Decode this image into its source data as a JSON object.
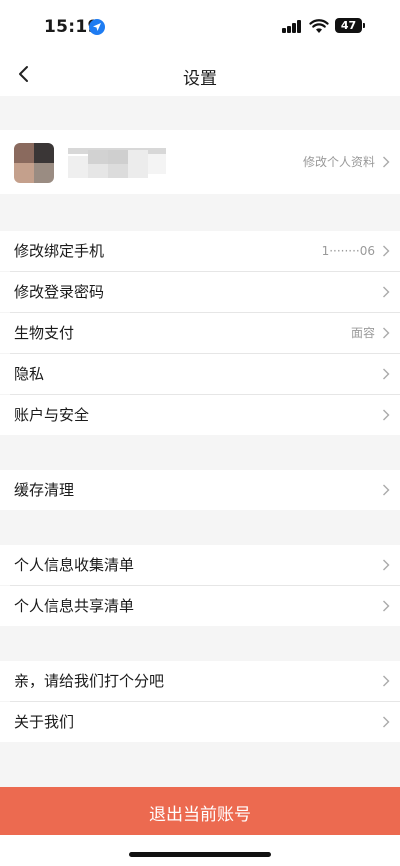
{
  "status_bar": {
    "time": "15:19",
    "battery": "47"
  },
  "nav": {
    "title": "设置"
  },
  "profile": {
    "edit_label": "修改个人资料"
  },
  "menu": [
    {
      "label": "修改绑定手机",
      "value": "1········06"
    },
    {
      "label": "修改登录密码",
      "value": ""
    },
    {
      "label": "生物支付",
      "value": "面容"
    },
    {
      "label": "隐私",
      "value": ""
    },
    {
      "label": "账户与安全",
      "value": ""
    },
    {
      "label": "缓存清理",
      "value": ""
    },
    {
      "label": "个人信息收集清单",
      "value": ""
    },
    {
      "label": "个人信息共享清单",
      "value": ""
    },
    {
      "label": "亲，请给我们打个分吧",
      "value": ""
    },
    {
      "label": "关于我们",
      "value": ""
    }
  ],
  "logout": {
    "label": "退出当前账号"
  },
  "colors": {
    "accent": "#ec6a50",
    "background": "#f5f5f5"
  }
}
